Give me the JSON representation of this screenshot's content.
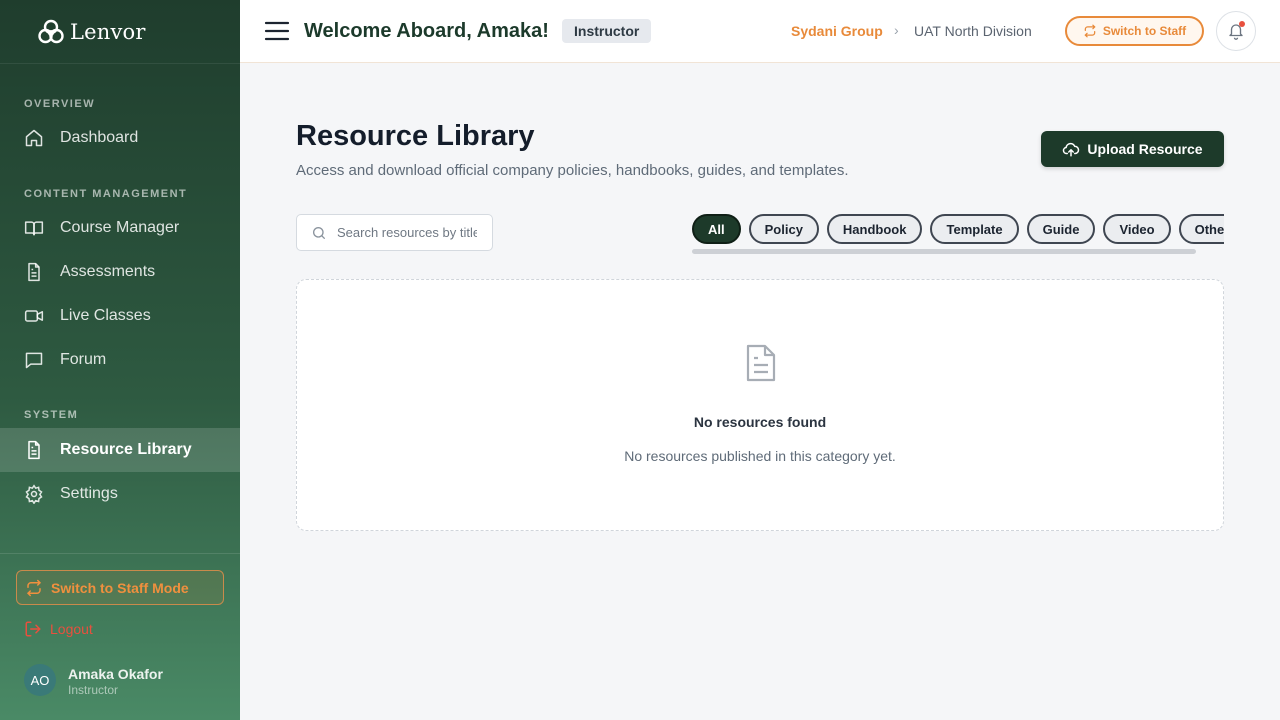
{
  "brand": {
    "name": "Lenvor"
  },
  "sidebar": {
    "sections": [
      {
        "title": "OVERVIEW"
      },
      {
        "title": "CONTENT MANAGEMENT"
      },
      {
        "title": "SYSTEM"
      }
    ],
    "items": [
      {
        "label": "Dashboard",
        "icon": "home-icon"
      },
      {
        "label": "Course Manager",
        "icon": "book-icon"
      },
      {
        "label": "Assessments",
        "icon": "document-icon"
      },
      {
        "label": "Live Classes",
        "icon": "video-icon"
      },
      {
        "label": "Forum",
        "icon": "chat-icon"
      },
      {
        "label": "Resource Library",
        "icon": "document-icon",
        "active": true
      },
      {
        "label": "Settings",
        "icon": "gear-icon"
      }
    ],
    "switch_mode_label": "Switch to Staff Mode",
    "logout_label": "Logout",
    "user": {
      "initials": "AO",
      "name": "Amaka Okafor",
      "role": "Instructor"
    }
  },
  "header": {
    "welcome": "Welcome Aboard, Amaka!",
    "role_badge": "Instructor",
    "breadcrumb": {
      "org": "Sydani Group",
      "separator": "›",
      "division": "UAT North Division"
    },
    "switch_label": "Switch to Staff"
  },
  "main": {
    "title": "Resource Library",
    "subtitle": "Access and download official company policies, handbooks, guides, and templates.",
    "upload_label": "Upload Resource",
    "search": {
      "placeholder": "Search resources by title...",
      "value": ""
    },
    "filters": [
      "All",
      "Policy",
      "Handbook",
      "Template",
      "Guide",
      "Video",
      "Other"
    ],
    "active_filter": "All",
    "empty": {
      "title": "No resources found",
      "subtitle": "No resources published in this category yet."
    }
  },
  "colors": {
    "accent": "#e88a3a",
    "primary": "#1d3a2a",
    "danger": "#e8503e"
  }
}
